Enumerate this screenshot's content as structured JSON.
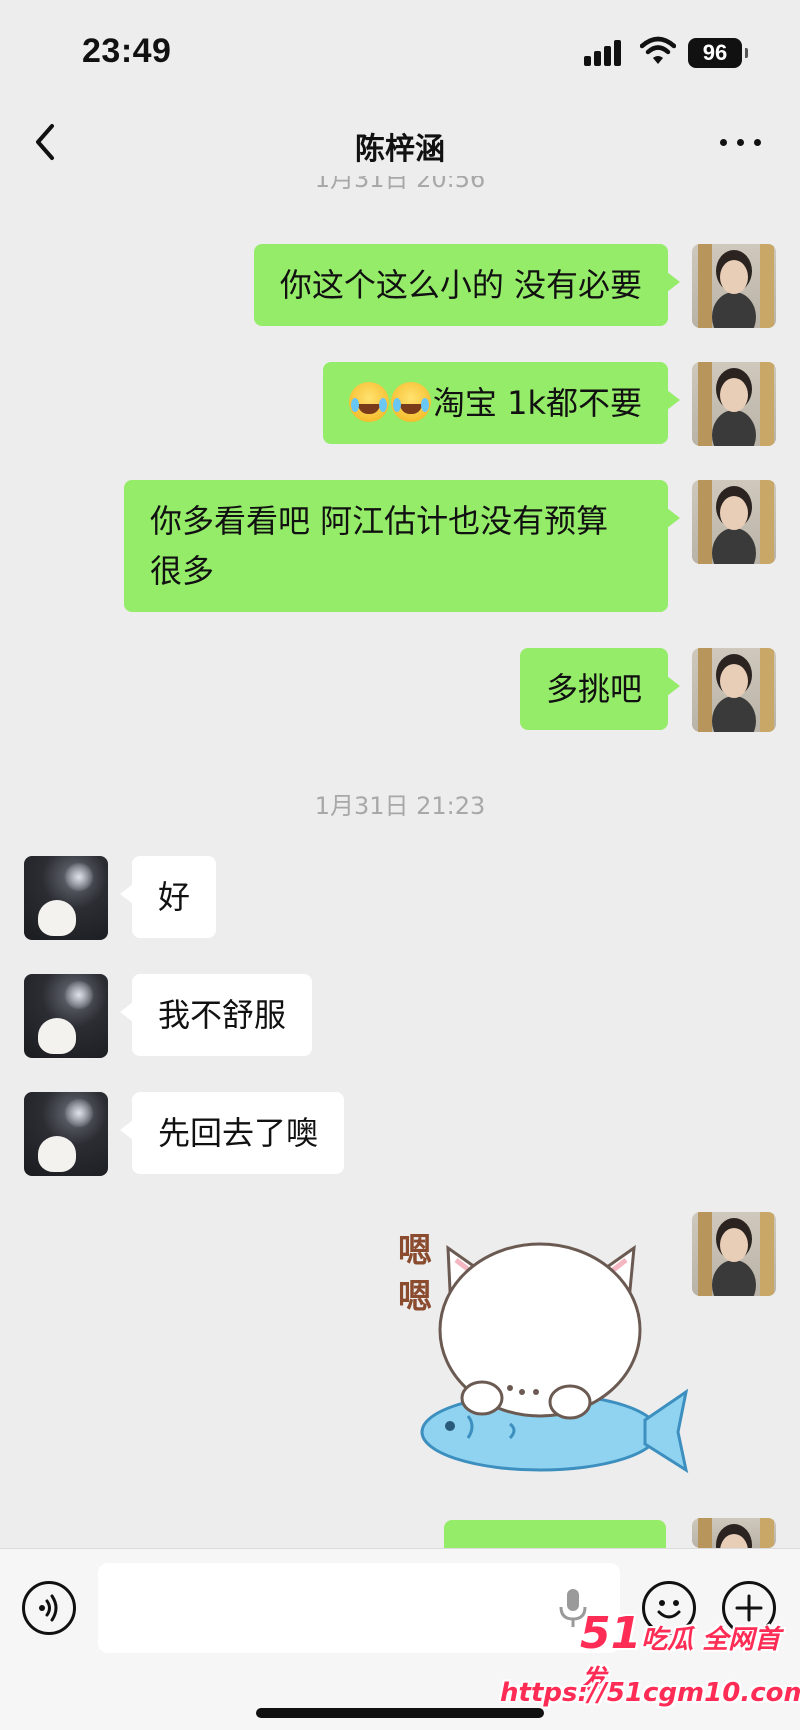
{
  "status_bar": {
    "time": "23:49",
    "battery": "96"
  },
  "nav": {
    "title": "陈梓涵"
  },
  "timestamps": {
    "partial": "1月31日 20:56",
    "second": "1月31日 21:23"
  },
  "messages": [
    {
      "sender": "self",
      "text": "你这个这么小的 没有必要"
    },
    {
      "sender": "self",
      "emoji_count": 2,
      "emoji": "rolling-laughing-emoji",
      "text": "淘宝 1k都不要"
    },
    {
      "sender": "self",
      "line1": "你多看看吧 阿江估计也没有预算",
      "line2": "很多"
    },
    {
      "sender": "self",
      "text": "多挑吧"
    },
    {
      "sender": "other",
      "text": "好"
    },
    {
      "sender": "other",
      "text": "我不舒服"
    },
    {
      "sender": "other",
      "text": "先回去了噢"
    },
    {
      "sender": "self",
      "sticker": "cat-on-fish-sticker",
      "sticker_text": "嗯嗯"
    },
    {
      "sender": "self",
      "text": ""
    }
  ],
  "input_bar": {
    "placeholder": ""
  },
  "watermark": {
    "brand": "51",
    "slogan": "吃瓜 全网首发",
    "url": "https://51cgm10.com"
  },
  "colors": {
    "self_bubble": "#95ec69",
    "other_bubble": "#ffffff",
    "background": "#ededed"
  }
}
